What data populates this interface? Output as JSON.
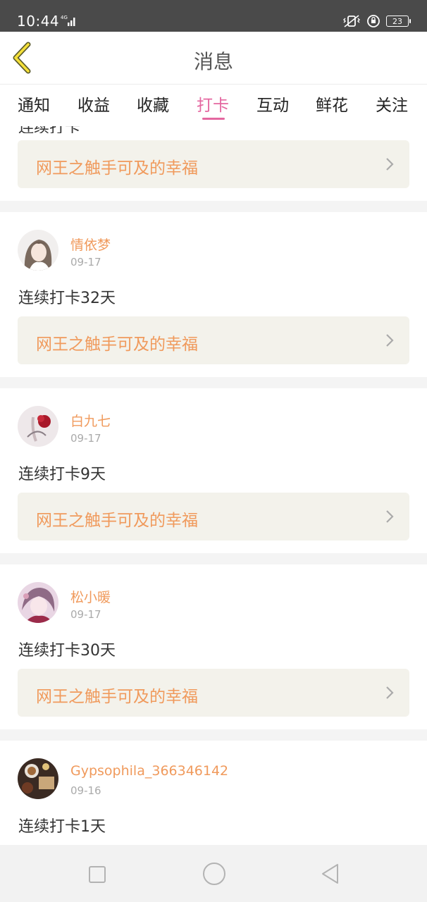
{
  "status_bar": {
    "time": "10:44",
    "network": "4G",
    "battery": "23"
  },
  "header": {
    "title": "消息",
    "back_icon": "chevron-left-icon"
  },
  "tabs": [
    {
      "label": "通知",
      "active": false
    },
    {
      "label": "收益",
      "active": false
    },
    {
      "label": "收藏",
      "active": false
    },
    {
      "label": "打卡",
      "active": true
    },
    {
      "label": "互动",
      "active": false
    },
    {
      "label": "鲜花",
      "active": false
    },
    {
      "label": "关注",
      "active": false
    }
  ],
  "colors": {
    "accent": "#e467a0",
    "username": "#f09a5c",
    "link_bg": "#f3f2eb"
  },
  "first_item": {
    "message": "连续打卡",
    "link": "网王之触手可及的幸福"
  },
  "items": [
    {
      "user": "情依梦",
      "date": "09-17",
      "message": "连续打卡32天",
      "link": "网王之触手可及的幸福"
    },
    {
      "user": "白九七",
      "date": "09-17",
      "message": "连续打卡9天",
      "link": "网王之触手可及的幸福"
    },
    {
      "user": "松小暖",
      "date": "09-17",
      "message": "连续打卡30天",
      "link": "网王之触手可及的幸福"
    },
    {
      "user": "Gypsophila_366346142",
      "date": "09-16",
      "message": "连续打卡1天"
    }
  ]
}
